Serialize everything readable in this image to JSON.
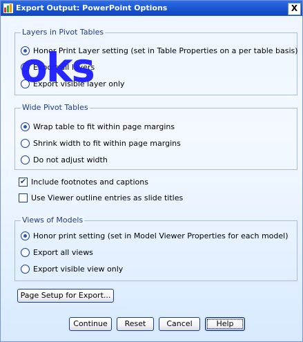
{
  "window": {
    "title": "Export Output: PowerPoint Options",
    "close_glyph": "X",
    "icon": "spss-app-icon"
  },
  "watermark": {
    "text": "oks"
  },
  "layers_group": {
    "legend": "Layers in Pivot Tables",
    "options": [
      {
        "label": "Honor Print Layer setting (set in Table Properties on a per table basis)",
        "selected": true
      },
      {
        "label": "Export all layers",
        "selected": false
      },
      {
        "label": "Export visible layer only",
        "selected": false
      }
    ]
  },
  "wide_group": {
    "legend": "Wide Pivot Tables",
    "options": [
      {
        "label": "Wrap table to fit within page margins",
        "selected": true
      },
      {
        "label": "Shrink width to fit within page margins",
        "selected": false
      },
      {
        "label": "Do not adjust width",
        "selected": false
      }
    ]
  },
  "checkboxes": [
    {
      "label": "Include footnotes and captions",
      "checked": true
    },
    {
      "label": "Use Viewer outline entries as slide titles",
      "checked": false
    }
  ],
  "models_group": {
    "legend": "Views of Models",
    "options": [
      {
        "label": "Honor print setting (set in Model Viewer Properties for each model)",
        "selected": true
      },
      {
        "label": "Export all views",
        "selected": false
      },
      {
        "label": "Export visible view only",
        "selected": false
      }
    ]
  },
  "buttons": {
    "page_setup": "Page Setup for Export...",
    "continue": "Continue",
    "reset": "Reset",
    "cancel": "Cancel",
    "help": "Help"
  }
}
